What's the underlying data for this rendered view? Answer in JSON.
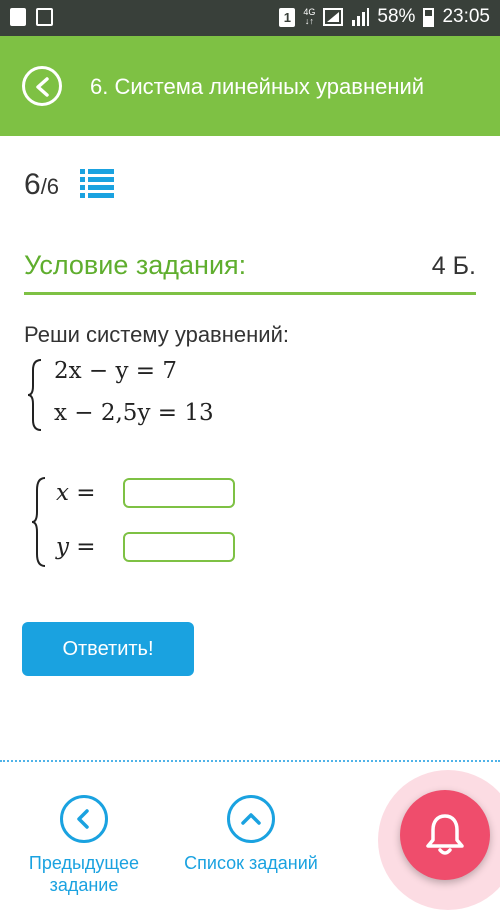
{
  "status_bar": {
    "sim": "1",
    "network": "4G",
    "battery": "58%",
    "time": "23:05"
  },
  "header": {
    "title": "6. Система линейных уравнений"
  },
  "progress": {
    "current": "6",
    "total": "/6"
  },
  "section": {
    "title": "Условие задания:",
    "points": "4 Б."
  },
  "task": {
    "prompt": "Реши систему уравнений:",
    "equation_1": "2x − y = 7",
    "equation_2": "x − 2,5y = 13"
  },
  "answer": {
    "x_label": "x =",
    "y_label": "y =",
    "x_value": "",
    "y_value": ""
  },
  "submit_label": "Ответить!",
  "bottom_nav": {
    "prev_label": "Предыдущее задание",
    "list_label": "Список заданий"
  },
  "colors": {
    "accent_green": "#7ec144",
    "accent_blue": "#1aa2e0",
    "bell_pink": "#ef4d6c"
  }
}
